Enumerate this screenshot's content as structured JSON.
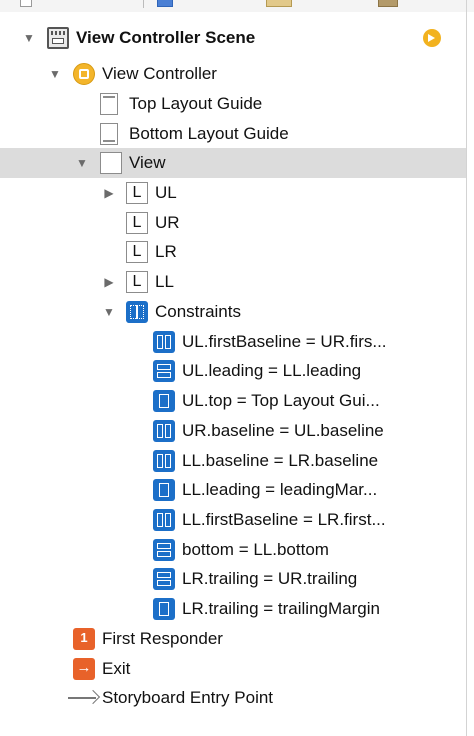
{
  "outline": {
    "scene": {
      "label": "View Controller Scene",
      "icon": "scene-icon"
    },
    "view_controller": {
      "label": "View Controller",
      "icon": "view-controller-icon"
    },
    "top_layout_guide": {
      "label": "Top Layout Guide"
    },
    "bottom_layout_guide": {
      "label": "Bottom Layout Guide"
    },
    "view": {
      "label": "View"
    },
    "labels": [
      {
        "glyph": "L",
        "label": "UL",
        "expandable": true
      },
      {
        "glyph": "L",
        "label": "UR",
        "expandable": false
      },
      {
        "glyph": "L",
        "label": "LR",
        "expandable": false
      },
      {
        "glyph": "L",
        "label": "LL",
        "expandable": true
      }
    ],
    "constraints_group": {
      "label": "Constraints"
    },
    "constraints": [
      "UL.firstBaseline = UR.firs...",
      "UL.leading = LL.leading",
      "UL.top = Top Layout Gui...",
      "UR.baseline = UL.baseline",
      "LL.baseline = LR.baseline",
      "LL.leading = leadingMar...",
      "LL.firstBaseline = LR.first...",
      "bottom = LL.bottom",
      "LR.trailing = UR.trailing",
      "LR.trailing = trailingMargin"
    ],
    "first_responder": {
      "label": "First Responder"
    },
    "exit": {
      "label": "Exit"
    },
    "entry_point": {
      "label": "Storyboard Entry Point"
    }
  },
  "colors": {
    "selection": "#dcdcdc",
    "constraint_blue": "#1c6fc8",
    "vc_yellow": "#f3b52b",
    "responder_orange": "#e8622a"
  }
}
